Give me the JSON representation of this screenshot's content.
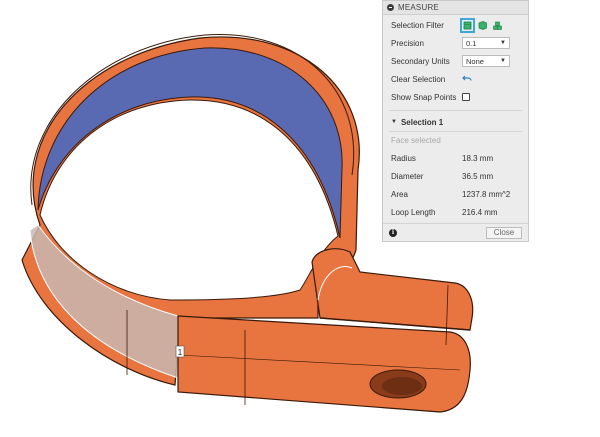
{
  "panel": {
    "title": "MEASURE",
    "selection_filter_label": "Selection Filter",
    "selection_filter_icons": [
      "face-filter-icon",
      "body-filter-icon",
      "component-filter-icon"
    ],
    "precision_label": "Precision",
    "precision_value": "0.1",
    "secondary_units_label": "Secondary Units",
    "secondary_units_value": "None",
    "clear_selection_label": "Clear Selection",
    "show_snap_points_label": "Show Snap Points",
    "show_snap_points_checked": false
  },
  "selection": {
    "title": "Selection 1",
    "status": "Face selected",
    "measurements": [
      {
        "label": "Radius",
        "value": "18.3 mm"
      },
      {
        "label": "Diameter",
        "value": "36.5 mm"
      },
      {
        "label": "Area",
        "value": "1237.8 mm^2"
      },
      {
        "label": "Loop Length",
        "value": "216.4 mm"
      }
    ]
  },
  "footer": {
    "close_label": "Close"
  },
  "viewport": {
    "selection_marker": "1",
    "colors": {
      "body": "#e8743f",
      "inner_face": "#5a6ab2",
      "edge": "#3a1a0a",
      "highlight": "#c9b7b3"
    }
  }
}
